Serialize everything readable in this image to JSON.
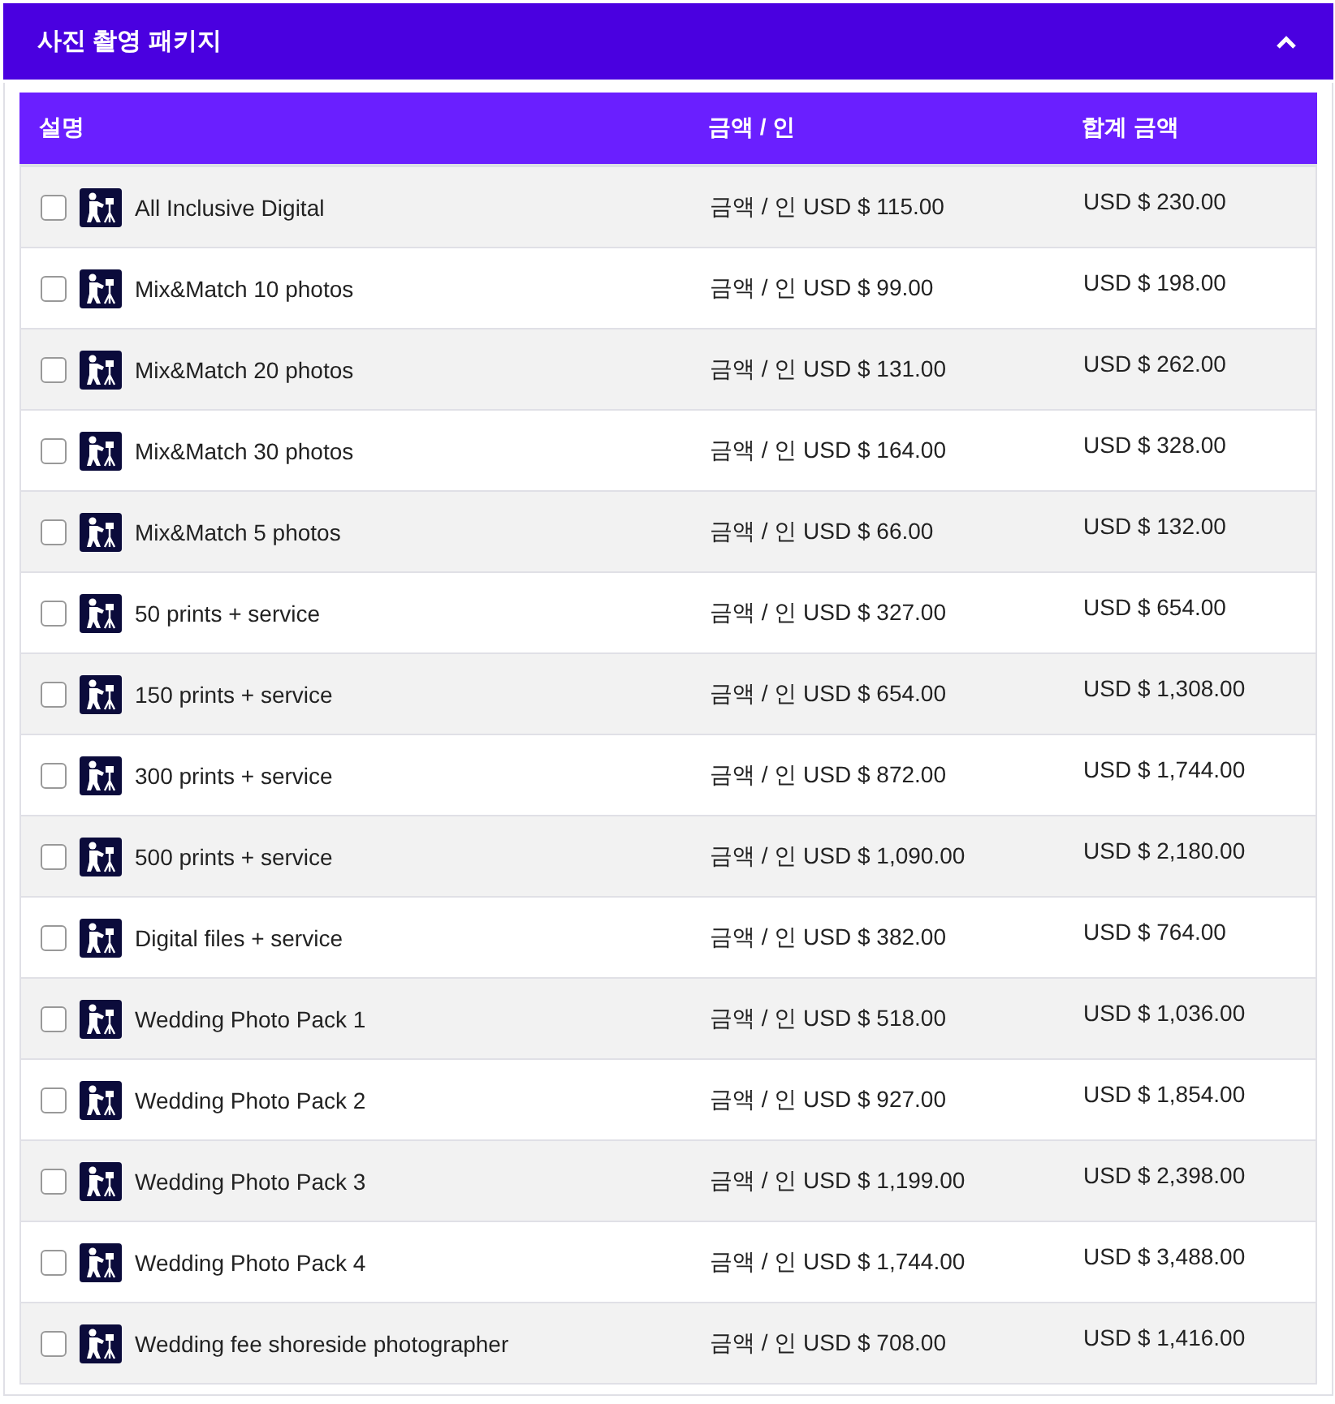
{
  "panel": {
    "title": "사진 촬영 패키지",
    "expanded": true
  },
  "table": {
    "columns": [
      "설명",
      "금액 / 인",
      "합계 금액"
    ],
    "rows": [
      {
        "checked": false,
        "description": "All Inclusive Digital",
        "price": "금액 / 인 USD $ 115.00",
        "total": "USD $ 230.00"
      },
      {
        "checked": false,
        "description": "Mix&Match 10 photos",
        "price": "금액 / 인 USD $ 99.00",
        "total": "USD $ 198.00"
      },
      {
        "checked": false,
        "description": "Mix&Match 20 photos",
        "price": "금액 / 인 USD $ 131.00",
        "total": "USD $ 262.00"
      },
      {
        "checked": false,
        "description": "Mix&Match 30 photos",
        "price": "금액 / 인 USD $ 164.00",
        "total": "USD $ 328.00"
      },
      {
        "checked": false,
        "description": "Mix&Match 5 photos",
        "price": "금액 / 인 USD $ 66.00",
        "total": "USD $ 132.00"
      },
      {
        "checked": false,
        "description": "50 prints + service",
        "price": "금액 / 인 USD $ 327.00",
        "total": "USD $ 654.00"
      },
      {
        "checked": false,
        "description": "150 prints + service",
        "price": "금액 / 인 USD $ 654.00",
        "total": "USD $ 1,308.00"
      },
      {
        "checked": false,
        "description": "300 prints + service",
        "price": "금액 / 인 USD $ 872.00",
        "total": "USD $ 1,744.00"
      },
      {
        "checked": false,
        "description": "500 prints + service",
        "price": "금액 / 인 USD $ 1,090.00",
        "total": "USD $ 2,180.00"
      },
      {
        "checked": false,
        "description": "Digital files + service",
        "price": "금액 / 인 USD $ 382.00",
        "total": "USD $ 764.00"
      },
      {
        "checked": false,
        "description": "Wedding Photo Pack 1",
        "price": "금액 / 인 USD $ 518.00",
        "total": "USD $ 1,036.00"
      },
      {
        "checked": false,
        "description": "Wedding Photo Pack 2",
        "price": "금액 / 인 USD $ 927.00",
        "total": "USD $ 1,854.00"
      },
      {
        "checked": false,
        "description": "Wedding Photo Pack 3",
        "price": "금액 / 인 USD $ 1,199.00",
        "total": "USD $ 2,398.00"
      },
      {
        "checked": false,
        "description": "Wedding Photo Pack 4",
        "price": "금액 / 인 USD $ 1,744.00",
        "total": "USD $ 3,488.00"
      },
      {
        "checked": false,
        "description": "Wedding fee shoreside photographer",
        "price": "금액 / 인 USD $ 708.00",
        "total": "USD $ 1,416.00"
      }
    ]
  }
}
